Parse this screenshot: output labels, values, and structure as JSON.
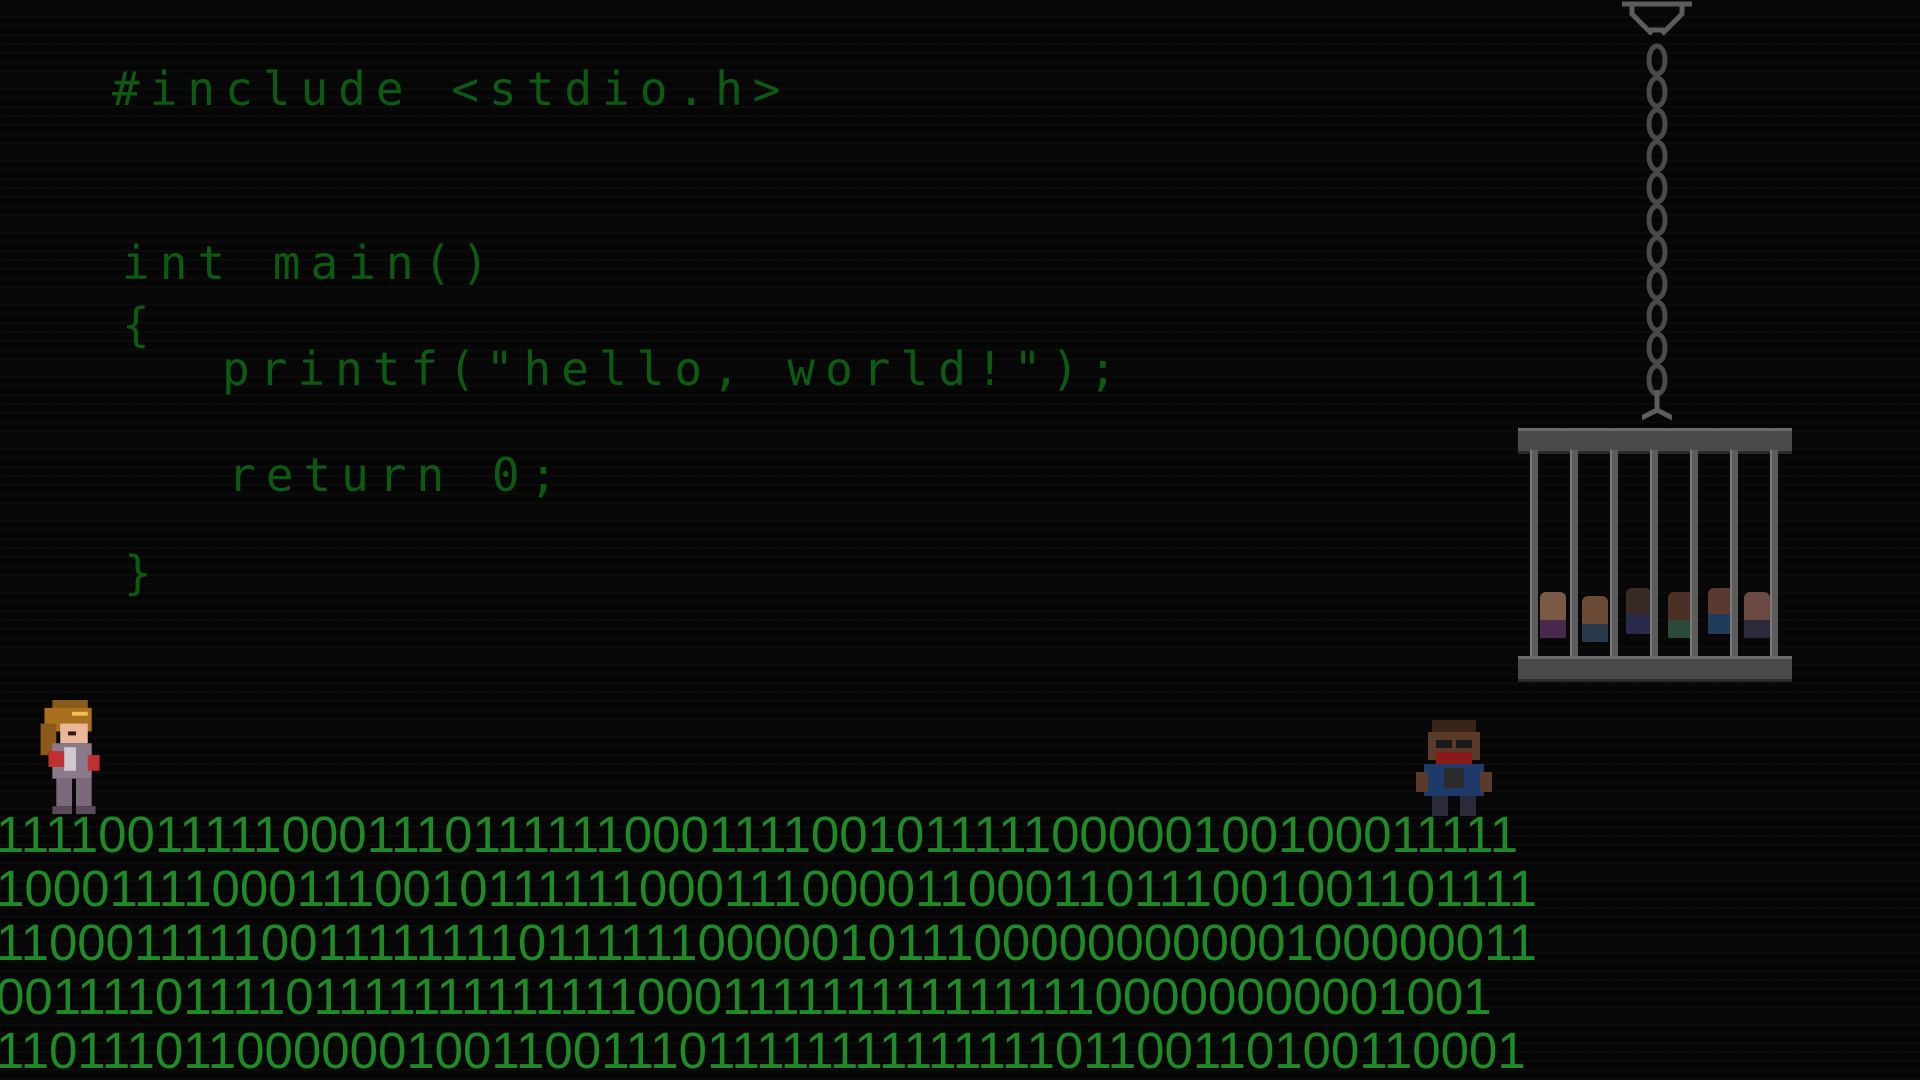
{
  "code": {
    "include_line": "#include <stdio.h>",
    "signature_line": "int main()",
    "open_brace": "{",
    "printf_line": "printf(\"hello, world!\");",
    "return_line": "return 0;",
    "close_brace": "}"
  },
  "binary_floor": {
    "rows": [
      "111100111110001110111111000111100101111100000100100011111",
      "100011110001110010111111000111000011000110111001001101111",
      "110001111100111111110111111000001011100000000000100000011",
      "001111011110111111111111100011111111111111100000000001001",
      "110111011000000100110011101111111111111101100110100110001"
    ]
  },
  "scene": {
    "player_character": "hero-girl-sprite",
    "enemy_character": "masked-thug-sprite",
    "cage": "hanging-cage-with-prisoners"
  },
  "colors": {
    "code_text": "#0d5a12",
    "binary_text": "#1f8a26",
    "background": "#060606",
    "cage_metal": "#5c5c5c"
  }
}
